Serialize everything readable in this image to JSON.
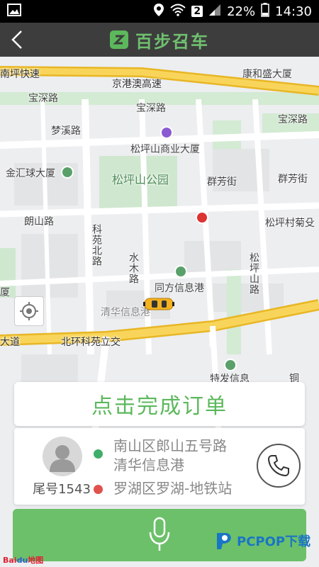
{
  "status_bar": {
    "battery": "22%",
    "time": "14:30",
    "sim": "2"
  },
  "header": {
    "title": "百步召车"
  },
  "map": {
    "labels": {
      "nanping": "南坪快速",
      "jinggang": "京港澳高速",
      "kanghe": "康和盛大厦",
      "baoshen1": "宝深路",
      "baoshen2": "宝深路",
      "baoshen3": "宝深路",
      "mengxi": "梦溪路",
      "songping_mall": "松坪山商业大厦",
      "jinhui": "金汇球大厦",
      "songping_park": "松坪山公园",
      "qunfang1": "群芳街",
      "qunfang2": "群芳街",
      "langshan": "朗山路",
      "songping_village": "松坪村菊殳",
      "keyuan_north": "科苑北路",
      "shuimu": "水木路",
      "songping_mtn": "松坪山路",
      "tongfang": "同方信息港",
      "xia": "厦",
      "qinghua": "清华信息港",
      "dadao": "大道",
      "beihuan": "北环科苑立交",
      "texin": "特发信息",
      "yin": "铜"
    }
  },
  "actions": {
    "complete_label": "点击完成订单"
  },
  "trip": {
    "tail_number": "尾号1543",
    "from_line1": "南山区郎山五号路",
    "from_line2": "清华信息港",
    "to": "罗湖区罗湖-地铁站"
  },
  "watermark": {
    "text": "PCPOP下载"
  },
  "map_attribution": {
    "bai": "Bai",
    "du": "du",
    "suffix": "地图"
  },
  "colors": {
    "brand_green": "#5cb85c",
    "header_bg": "#3d3d3d",
    "dot_from": "#3fae6a",
    "dot_to": "#e0524d",
    "highway": "#f4c430"
  }
}
